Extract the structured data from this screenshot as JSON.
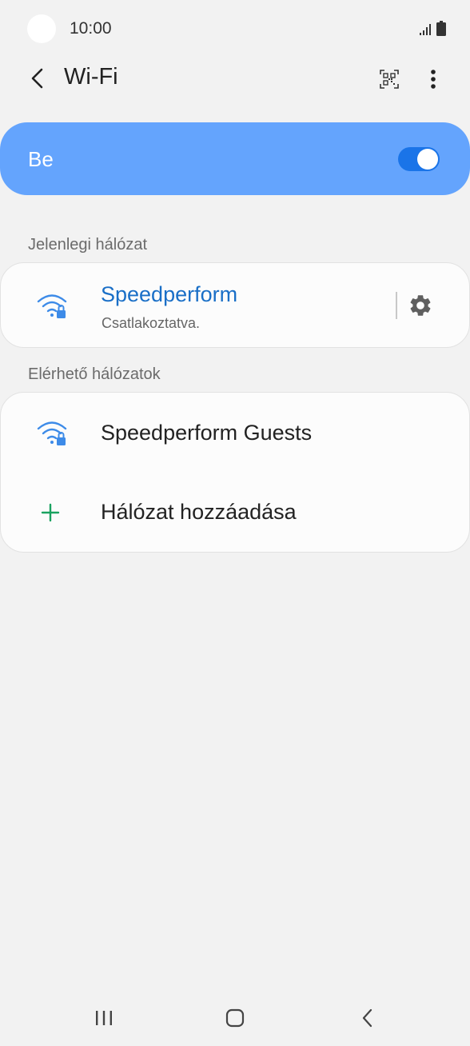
{
  "status_bar": {
    "time": "10:00",
    "icons": [
      "signal-icon",
      "battery-icon"
    ]
  },
  "header": {
    "title": "Wi-Fi",
    "icons": [
      "back-arrow-icon",
      "qr-code-icon",
      "more-vert-icon"
    ]
  },
  "master": {
    "label": "Be",
    "enabled": true
  },
  "current_section": {
    "label": "Jelenlegi hálózat",
    "network": {
      "name": "Speedperform",
      "status": "Csatlakoztatva.",
      "icon": "wifi-lock-icon"
    }
  },
  "available_section": {
    "label": "Elérhető hálózatok",
    "items": [
      {
        "name": "Speedperform Guests",
        "icon": "wifi-lock-icon"
      },
      {
        "name": "Hálózat hozzáadása",
        "icon": "plus-icon"
      }
    ]
  },
  "colors": {
    "background": "#f2f2f2",
    "toggle_banner": "#64a4fd",
    "switch_on": "#1a74e8",
    "connected_text": "#1a6fc7",
    "wifi_icon": "#3d8be8",
    "add_icon": "#1aa260"
  },
  "nav_bar": {
    "icons": [
      "recent-apps-icon",
      "home-icon",
      "back-icon"
    ]
  }
}
